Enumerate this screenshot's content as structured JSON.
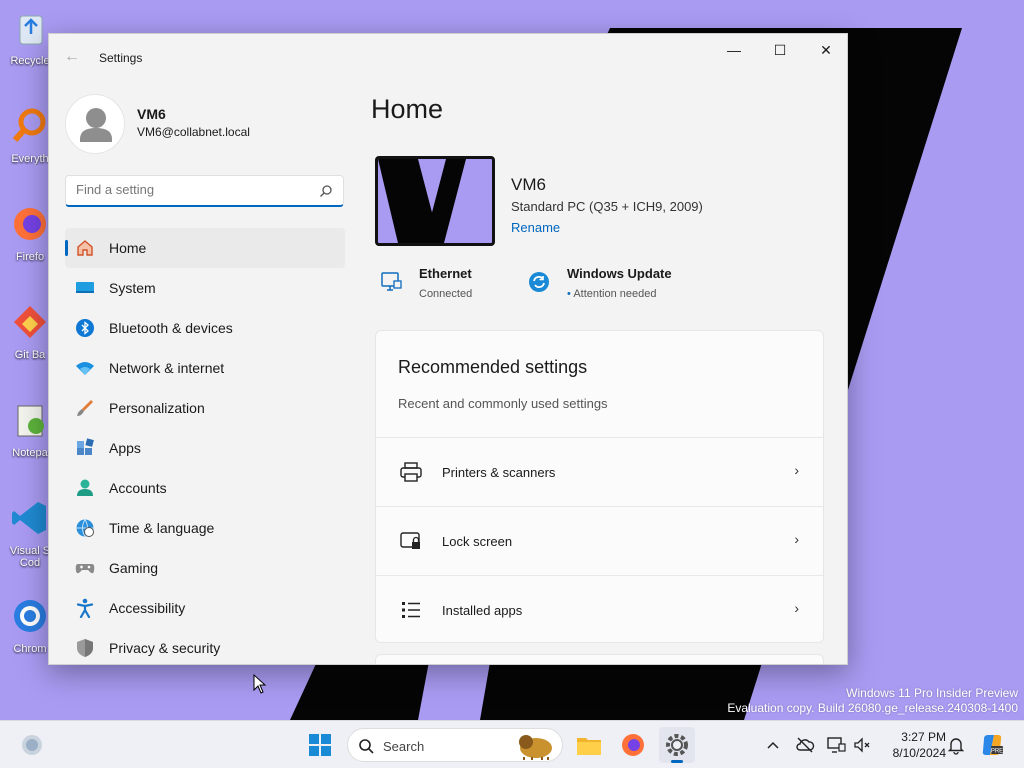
{
  "desktop": {
    "icons": [
      {
        "label": "Recycle",
        "icon": "recycle-bin-icon"
      },
      {
        "label": "Everyth",
        "icon": "everything-search-icon"
      },
      {
        "label": "Firefo",
        "icon": "firefox-icon"
      },
      {
        "label": "Git Ba",
        "icon": "git-bash-icon"
      },
      {
        "label": "Notepa",
        "icon": "notepad-plus-icon"
      },
      {
        "label": "Visual S",
        "label2": "Cod",
        "icon": "vscode-icon"
      },
      {
        "label": "Chrom",
        "icon": "chrome-icon"
      }
    ],
    "watermark": {
      "line1": "Windows 11 Pro Insider Preview",
      "line2": "Evaluation copy. Build 26080.ge_release.240308-1400"
    }
  },
  "window": {
    "title": "Settings",
    "back": "←",
    "minimize": "—",
    "maximize": "☐",
    "close": "✕"
  },
  "profile": {
    "name": "VM6",
    "email": "VM6@collabnet.local"
  },
  "search": {
    "placeholder": "Find a setting"
  },
  "nav": {
    "items": [
      {
        "label": "Home",
        "icon": "home-icon",
        "active": true
      },
      {
        "label": "System",
        "icon": "system-icon"
      },
      {
        "label": "Bluetooth & devices",
        "icon": "bluetooth-icon"
      },
      {
        "label": "Network & internet",
        "icon": "network-icon"
      },
      {
        "label": "Personalization",
        "icon": "brush-icon"
      },
      {
        "label": "Apps",
        "icon": "apps-icon"
      },
      {
        "label": "Accounts",
        "icon": "accounts-icon"
      },
      {
        "label": "Time & language",
        "icon": "globe-clock-icon"
      },
      {
        "label": "Gaming",
        "icon": "gamepad-icon"
      },
      {
        "label": "Accessibility",
        "icon": "accessibility-icon"
      },
      {
        "label": "Privacy & security",
        "icon": "shield-icon"
      }
    ]
  },
  "main": {
    "title": "Home",
    "device": {
      "name": "VM6",
      "model": "Standard PC (Q35 + ICH9, 2009)",
      "rename": "Rename"
    },
    "status": {
      "ethernet": {
        "title": "Ethernet",
        "sub": "Connected",
        "icon": "ethernet-icon"
      },
      "update": {
        "title": "Windows Update",
        "sub": "Attention needed",
        "icon": "windows-update-icon"
      }
    },
    "recommended": {
      "title": "Recommended settings",
      "subtitle": "Recent and commonly used settings",
      "rows": [
        {
          "label": "Printers & scanners",
          "icon": "printer-icon"
        },
        {
          "label": "Lock screen",
          "icon": "lock-screen-icon"
        },
        {
          "label": "Installed apps",
          "icon": "installed-apps-icon"
        }
      ],
      "chevron": "›"
    }
  },
  "taskbar": {
    "search_label": "Search",
    "time": "3:27 PM",
    "date": "8/10/2024"
  },
  "colors": {
    "accent": "#0067c0",
    "wallpaper": "#a99bf2"
  }
}
